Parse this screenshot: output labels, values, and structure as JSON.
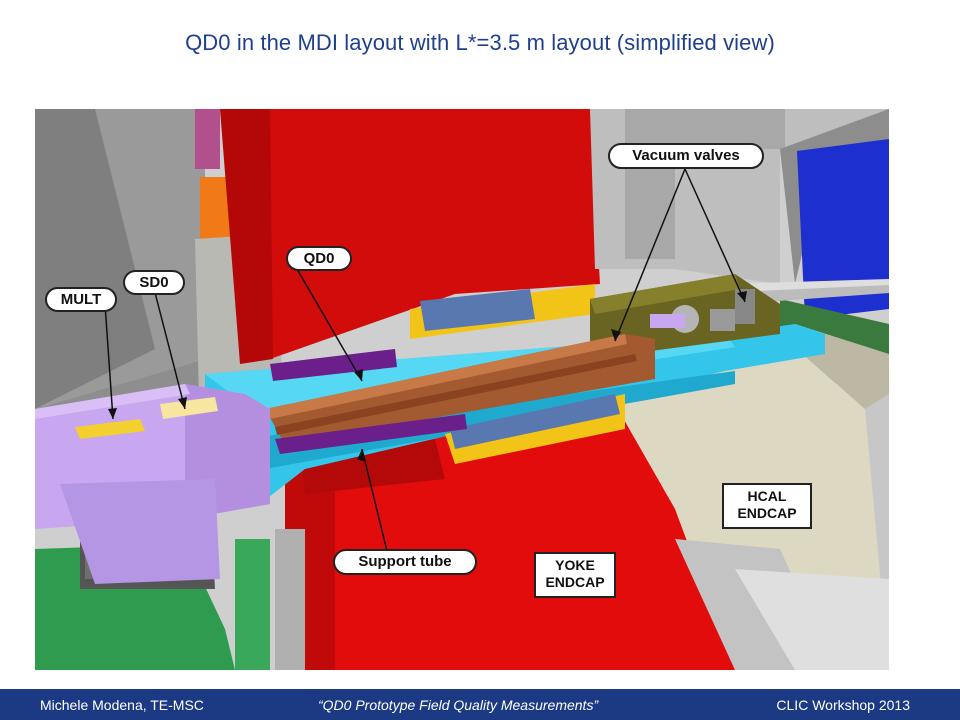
{
  "slide": {
    "title": "QD0 in the MDI layout with L*=3.5 m layout (simplified view)"
  },
  "figure": {
    "labels": {
      "vacuum_valves": "Vacuum valves",
      "qd0": "QD0",
      "sd0": "SD0",
      "mult": "MULT",
      "support_tube": "Support tube",
      "hcal_endcap": [
        "HCAL",
        "ENDCAP"
      ],
      "yoke_endcap": [
        "YOKE",
        "ENDCAP"
      ]
    },
    "colors": {
      "yoke_red": "#d40a0a",
      "support_cyan": "#2ec8e8",
      "qd0_copper": "#a0522d",
      "coil_purple": "#6a1f8a",
      "cryostat_lavender": "#c9a6f0",
      "hcal_beige": "#ddd8c4",
      "ecal_blue": "#1c2fd0",
      "floor_green": "#2b8a49"
    }
  },
  "footer": {
    "author": "Michele Modena, TE-MSC",
    "talk_title": "“QD0 Prototype Field Quality Measurements”",
    "event": "CLIC Workshop 2013"
  }
}
